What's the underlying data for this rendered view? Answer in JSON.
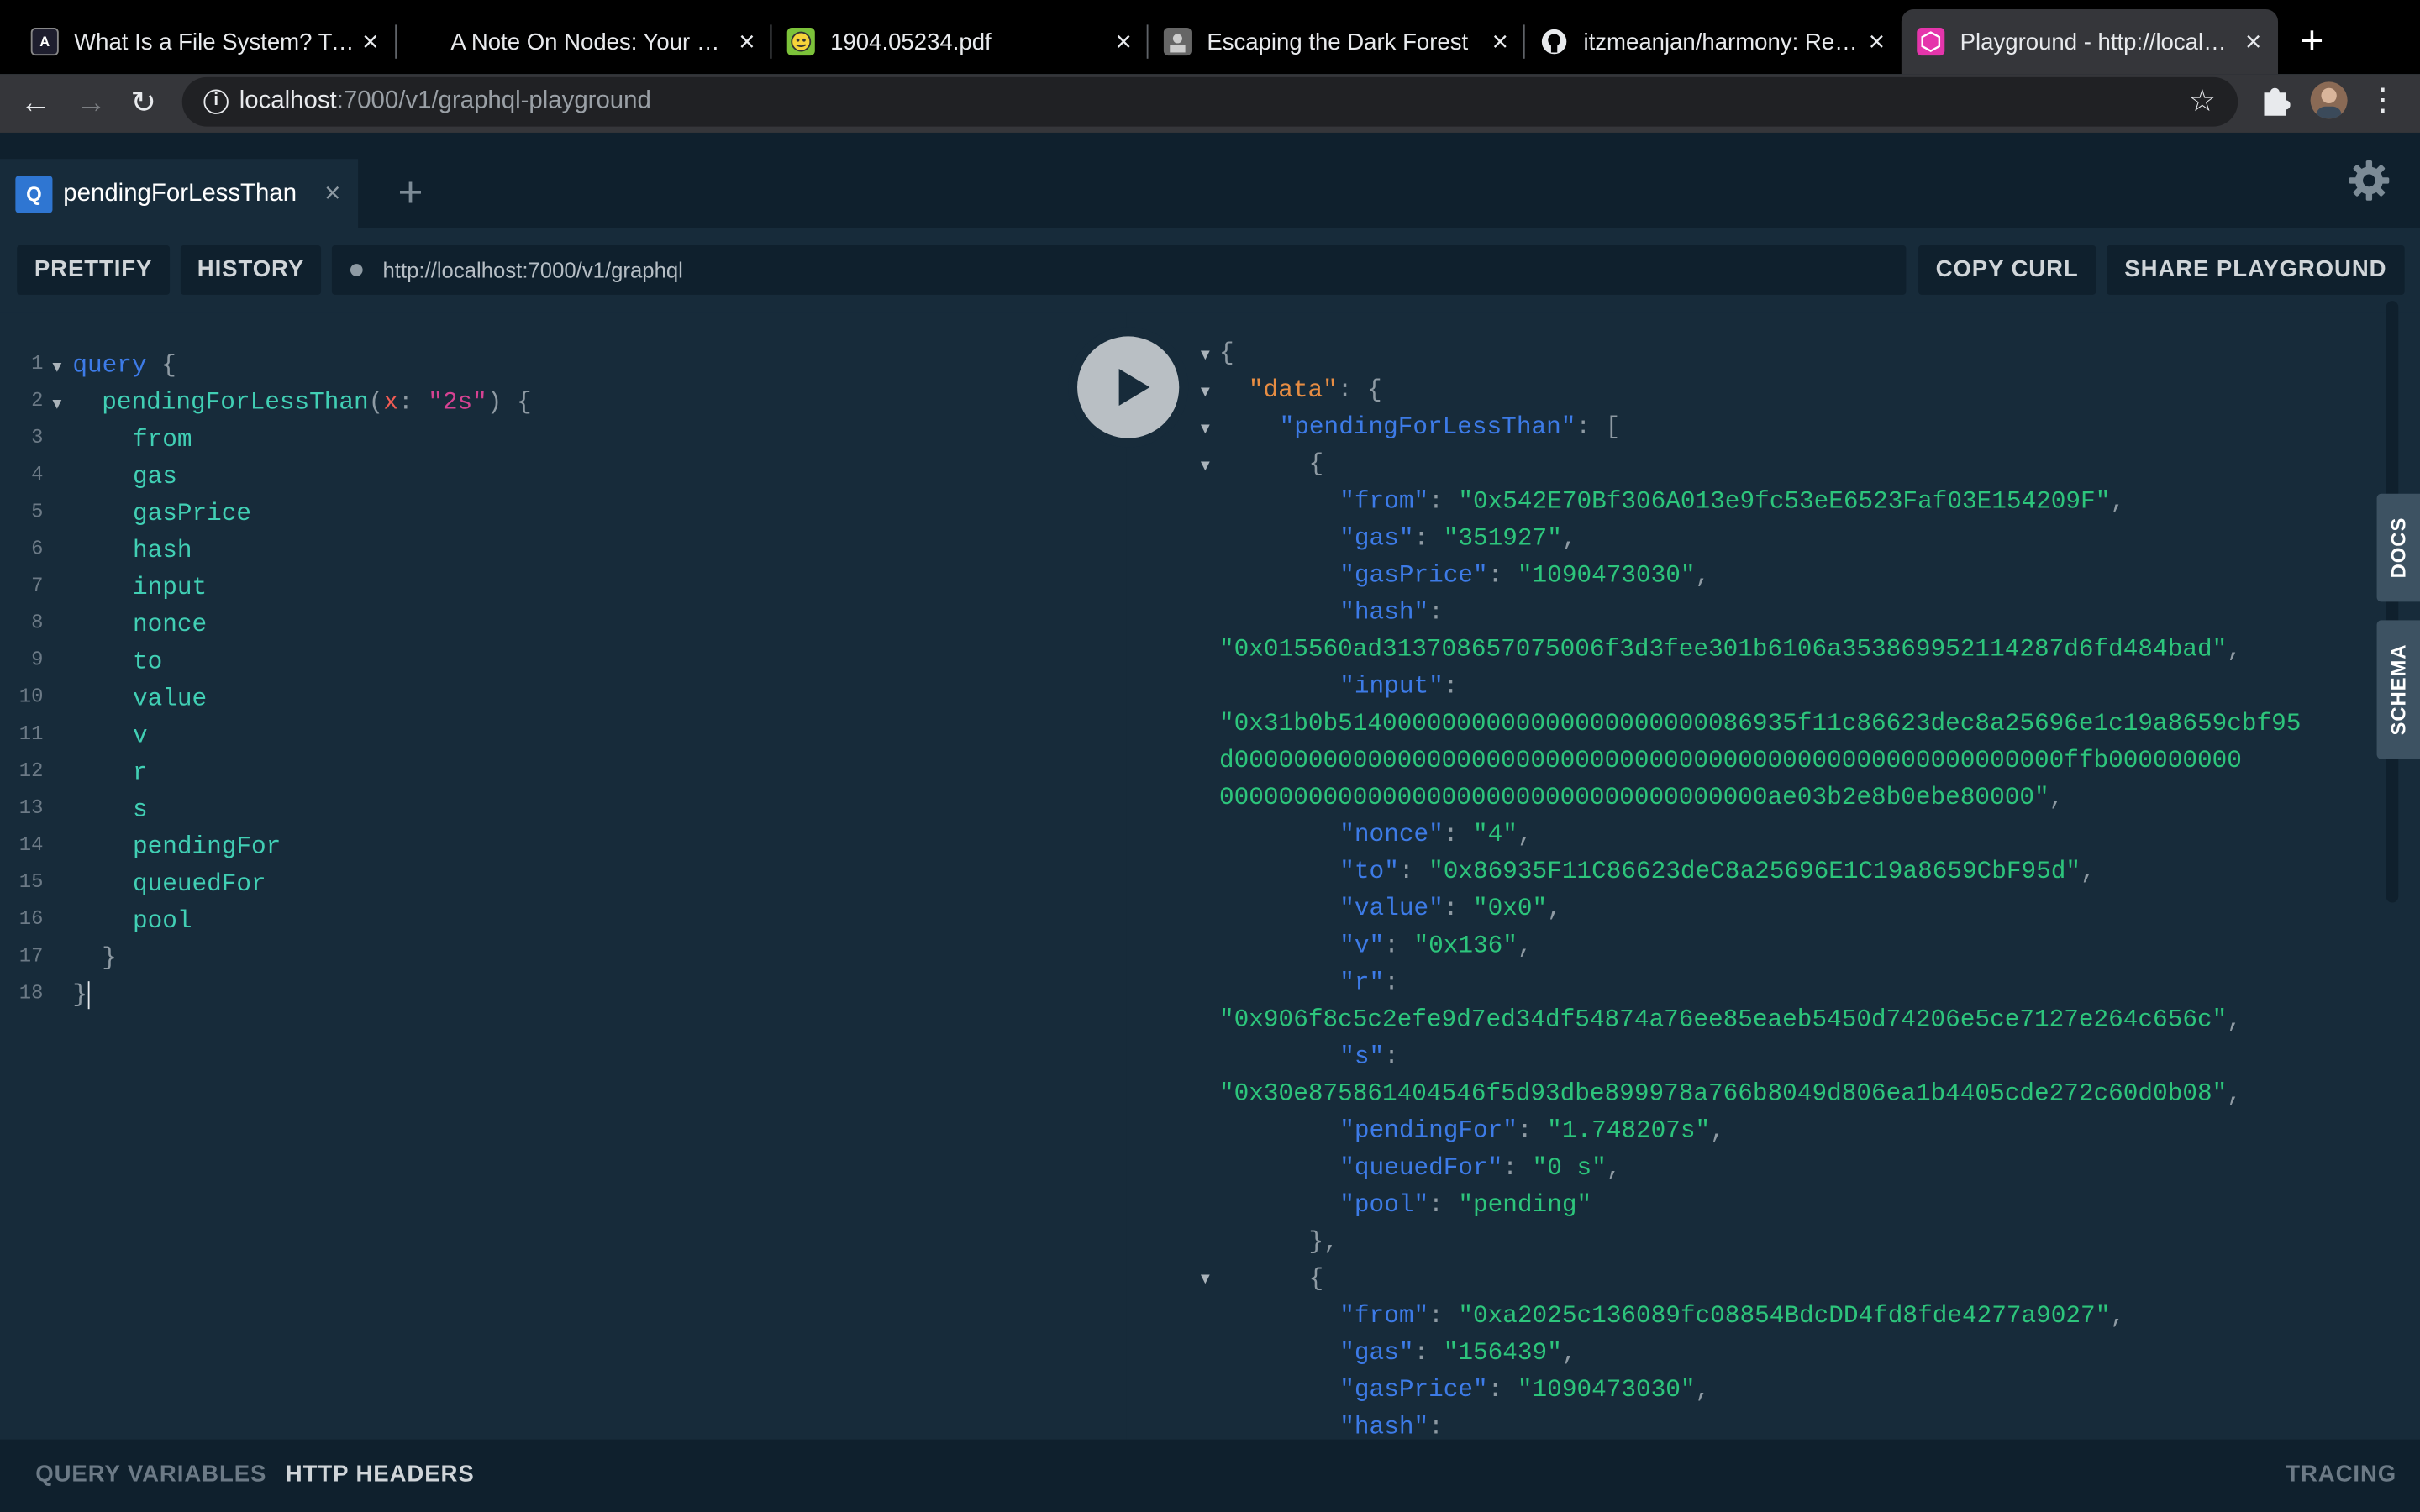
{
  "browser": {
    "tabs": [
      {
        "title": "What Is a File System? Types",
        "favicon": "A"
      },
      {
        "title": "A Note On Nodes: Your Gate",
        "favicon": ""
      },
      {
        "title": "1904.05234.pdf",
        "favicon": ""
      },
      {
        "title": "Escaping the Dark Forest",
        "favicon": ""
      },
      {
        "title": "itzmeanjan/harmony: Reduc",
        "favicon": ""
      },
      {
        "title": "Playground - http://localhost",
        "favicon": ""
      }
    ],
    "address": {
      "host": "localhost",
      "path": ":7000/v1/graphql-playground"
    }
  },
  "playground": {
    "tab_name": "pendingForLessThan",
    "tab_badge": "Q",
    "prettify": "PRETTIFY",
    "history": "HISTORY",
    "endpoint": "http://localhost:7000/v1/graphql",
    "copy_curl": "COPY CURL",
    "share": "SHARE PLAYGROUND",
    "docs": "DOCS",
    "schema": "SCHEMA",
    "query_variables": "QUERY VARIABLES",
    "http_headers": "HTTP HEADERS",
    "tracing": "TRACING"
  },
  "query": {
    "keyword": "query",
    "field": "pendingForLessThan",
    "arg_name": "x",
    "arg_value": "\"2s\"",
    "fields": [
      "from",
      "gas",
      "gasPrice",
      "hash",
      "input",
      "nonce",
      "to",
      "value",
      "v",
      "r",
      "s",
      "pendingFor",
      "queuedFor",
      "pool"
    ]
  },
  "result": {
    "data_key": "\"data\"",
    "list_key": "\"pendingForLessThan\"",
    "item1": {
      "from": "\"0x542E70Bf306A013e9fc53eE6523Faf03E154209F\"",
      "gas": "\"351927\"",
      "gasPrice": "\"1090473030\"",
      "hash": "\"0x015560ad313708657075006f3d3fee301b6106a353869952114287d6fd484bad\"",
      "input_1": "\"0x31b0b5140000000000000000000000086935f11c86623dec8a25696e1c19a8659cbf95",
      "input_2": "d00000000000000000000000000000000000000000000000000000000ffb000000000",
      "input_3": "0000000000000000000000000000000000000ae03b2e8b0ebe80000\"",
      "nonce": "\"4\"",
      "to": "\"0x86935F11C86623deC8a25696E1C19a8659CbF95d\"",
      "value": "\"0x0\"",
      "v": "\"0x136\"",
      "r": "\"0x906f8c5c2efe9d7ed34df54874a76ee85eaeb5450d74206e5ce7127e264c656c\"",
      "s": "\"0x30e875861404546f5d93dbe899978a766b8049d806ea1b4405cde272c60d0b08\"",
      "pendingFor": "\"1.748207s\"",
      "queuedFor": "\"0 s\"",
      "pool": "\"pending\""
    },
    "item2": {
      "from": "\"0xa2025c136089fc08854BdcDD4fd8fde4277a9027\"",
      "gas": "\"156439\"",
      "gasPrice": "\"1090473030\""
    },
    "keys": {
      "from": "\"from\"",
      "gas": "\"gas\"",
      "gasPrice": "\"gasPrice\"",
      "hash": "\"hash\"",
      "input": "\"input\"",
      "nonce": "\"nonce\"",
      "to": "\"to\"",
      "value": "\"value\"",
      "v": "\"v\"",
      "r": "\"r\"",
      "s": "\"s\"",
      "pendingFor": "\"pendingFor\"",
      "queuedFor": "\"queuedFor\"",
      "pool": "\"pool\""
    }
  },
  "colors": {
    "accent": "#e535ab",
    "bg": "#172b3a",
    "panel": "#0f202d"
  }
}
